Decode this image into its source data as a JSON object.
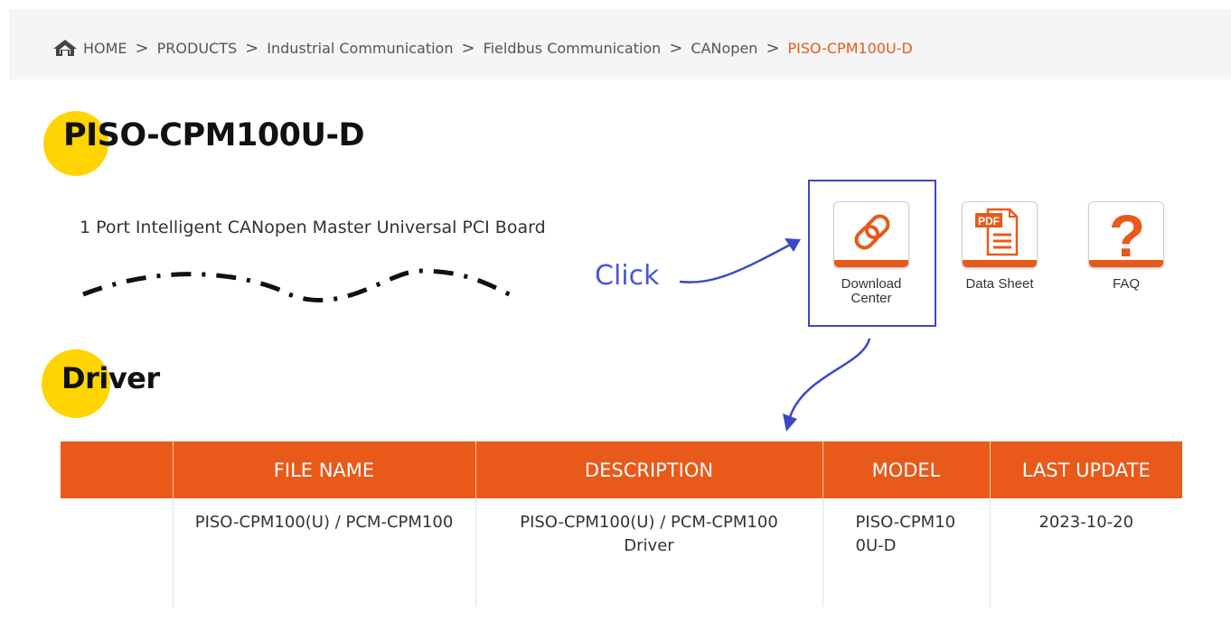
{
  "breadcrumb": {
    "home_icon": "home-icon",
    "separator": ">",
    "items": [
      "HOME",
      "PRODUCTS",
      "Industrial Communication",
      "Fieldbus Communication",
      "CANopen"
    ],
    "current": "PISO-CPM100U-D"
  },
  "product": {
    "title": "PISO-CPM100U-D",
    "subtitle": "1 Port Intelligent CANopen Master Universal PCI Board"
  },
  "annotation": {
    "click_label": "Click"
  },
  "tools": [
    {
      "label_line1": "Download",
      "label_line2": "Center",
      "icon": "link-icon"
    },
    {
      "label_line1": "Data Sheet",
      "label_line2": "",
      "icon": "pdf-icon"
    },
    {
      "label_line1": "FAQ",
      "label_line2": "",
      "icon": "question-icon"
    }
  ],
  "driver_section": {
    "heading": "Driver",
    "columns": [
      "",
      "FILE NAME",
      "DESCRIPTION",
      "MODEL",
      "LAST UPDATE"
    ],
    "rows": [
      {
        "file_name": "PISO-CPM100(U) / PCM-CPM100",
        "description": "PISO-CPM100(U) / PCM-CPM100 Driver",
        "model": "PISO-CPM100U-D",
        "last_update": "2023-10-20"
      }
    ]
  },
  "colors": {
    "accent": "#e8591a",
    "dot": "#ffd400",
    "annotation": "#3c48c8"
  }
}
